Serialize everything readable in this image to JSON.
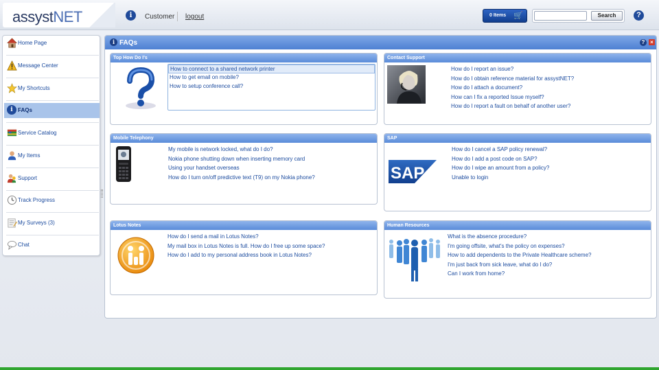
{
  "header": {
    "logo_main": "assyst",
    "logo_accent": "NET",
    "user": "Customer",
    "logout": "logout",
    "cart_label": "0 Items",
    "search_placeholder": "",
    "search_button": "Search"
  },
  "sidebar": {
    "items": [
      {
        "label": "Home Page",
        "icon": "home-icon"
      },
      {
        "label": "Message Center",
        "icon": "warning-icon"
      },
      {
        "label": "My Shortcuts",
        "icon": "star-icon"
      },
      {
        "label": "FAQs",
        "icon": "info-icon",
        "active": true
      },
      {
        "label": "Service Catalog",
        "icon": "catalog-icon"
      },
      {
        "label": "My Items",
        "icon": "person-icon"
      },
      {
        "label": "Support",
        "icon": "support-icon"
      },
      {
        "label": "Track Progress",
        "icon": "clock-icon"
      },
      {
        "label": "My Surveys (3)",
        "icon": "survey-icon"
      },
      {
        "label": "Chat",
        "icon": "chat-icon"
      }
    ]
  },
  "main": {
    "title": "FAQs",
    "panels": {
      "top_howdo": {
        "title": "Top How Do I's",
        "links": [
          "How to connect to a shared network printer",
          "How to get email on mobile?",
          "How to setup conference call?"
        ]
      },
      "contact_support": {
        "title": "Contact Support",
        "links": [
          "How do I report an issue?",
          "How do I obtain reference material for assystNET?",
          "How do I attach a document?",
          "How can I fix a reported Issue myself?",
          "How do I report a fault on behalf of another user?"
        ]
      },
      "mobile": {
        "title": "Mobile Telephony",
        "links": [
          "My mobile is network locked, what do I do?",
          "Nokia phone shutting down when inserting memory card",
          "Using your handset overseas",
          "How do I turn on/off predictive text (T9) on my Nokia phone?"
        ]
      },
      "sap": {
        "title": "SAP",
        "logo_text": "SAP",
        "links": [
          "How do I cancel a SAP policy renewal?",
          "How do I add a post code on SAP?",
          "How do I wipe an amount from a policy?",
          "Unable to login"
        ]
      },
      "lotus": {
        "title": "Lotus Notes",
        "links": [
          "How do I send a mail in Lotus Notes?",
          "My mail box in Lotus Notes is full. How do I free up some space?",
          "How do I add to my personal address book in Lotus Notes?"
        ]
      },
      "hr": {
        "title": "Human Resources",
        "links": [
          "What is the absence procedure?",
          "I'm going offsite, what's the policy on expenses?",
          "How to add dependents to the Private Healthcare scheme?",
          "I'm just back from sick leave, what do I do?",
          "Can I work from home?"
        ]
      }
    }
  }
}
